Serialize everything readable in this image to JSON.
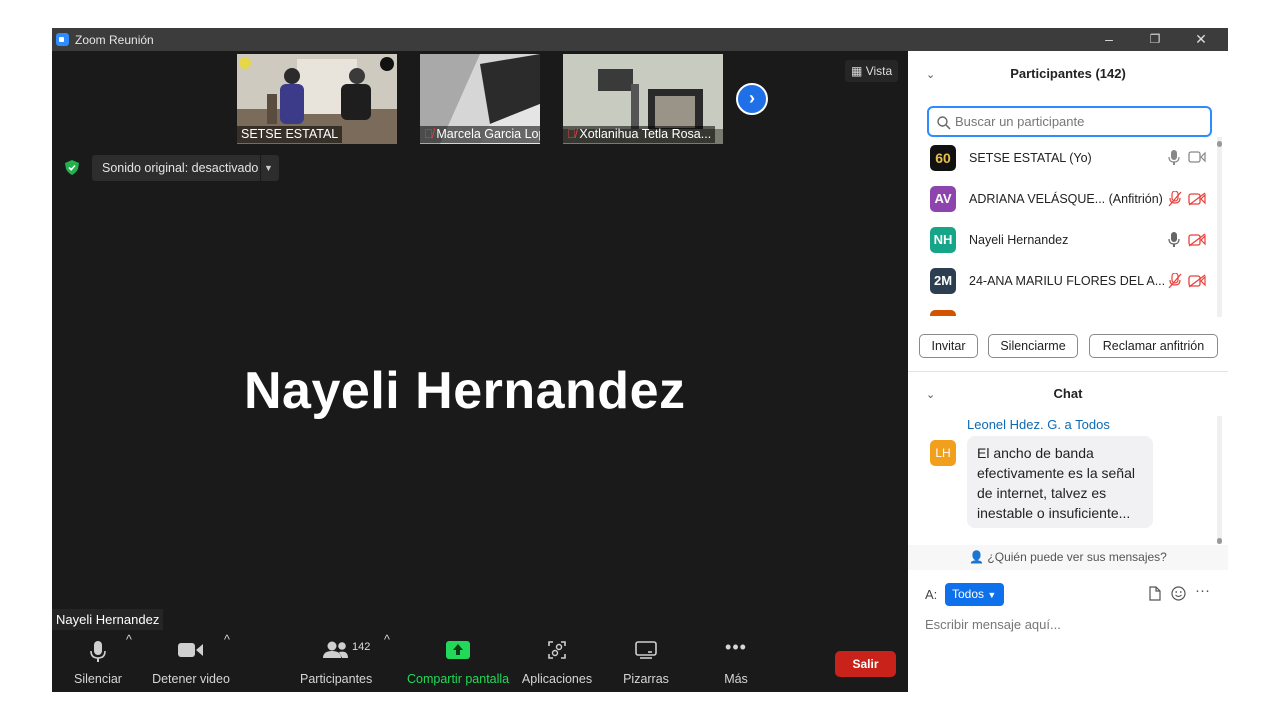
{
  "window": {
    "title": "Zoom Reunión",
    "controls": [
      "–",
      "❐",
      "✕"
    ]
  },
  "gallery": [
    {
      "name": "SETSE ESTATAL",
      "muted": false
    },
    {
      "name": "Marcela Garcia Lopez",
      "muted": true
    },
    {
      "name": "Xotlanihua Tetla Rosa...",
      "muted": true
    }
  ],
  "view_button": "Vista",
  "original_sound": "Sonido original: desactivado",
  "active_speaker": "Nayeli Hernandez",
  "name_tag": "Nayeli Hernandez",
  "toolbar": {
    "mute": "Silenciar",
    "video": "Detener video",
    "participants": "Participantes",
    "participants_count": "142",
    "share": "Compartir pantalla",
    "apps": "Aplicaciones",
    "whiteboards": "Pizarras",
    "more": "Más",
    "leave": "Salir"
  },
  "participants_panel": {
    "title": "Participantes (142)",
    "search_placeholder": "Buscar un participante",
    "list": [
      {
        "initials": "60",
        "name": "SETSE ESTATAL (Yo)",
        "color": "#111111",
        "mic": "on",
        "cam": "on"
      },
      {
        "initials": "AV",
        "name": "ADRIANA VELÁSQUE... (Anfitrión)",
        "color": "#8e44ad",
        "mic": "off",
        "cam": "off"
      },
      {
        "initials": "NH",
        "name": "Nayeli Hernandez",
        "color": "#17a589",
        "mic": "on",
        "cam": "off"
      },
      {
        "initials": "2M",
        "name": "24-ANA MARILU FLORES DEL A...",
        "color": "#2c3e50",
        "mic": "off",
        "cam": "off"
      }
    ],
    "buttons": {
      "invite": "Invitar",
      "mute_me": "Silenciarme",
      "claim_host": "Reclamar anfitrión"
    }
  },
  "chat": {
    "title": "Chat",
    "sender": "Leonel Hdez. G. a Todos",
    "sender_initials": "LH",
    "message": "El ancho de banda efectivamente es la señal de internet, talvez es inestable o insuficiente...",
    "who_can_see": "¿Quién puede ver sus mensajes?",
    "to_label": "A:",
    "to_value": "Todos",
    "input_placeholder": "Escribir mensaje aquí..."
  },
  "colors": {
    "accent": "#2d8cff",
    "leave": "#c9221b",
    "share": "#23d959",
    "muted": "#e8413c"
  }
}
